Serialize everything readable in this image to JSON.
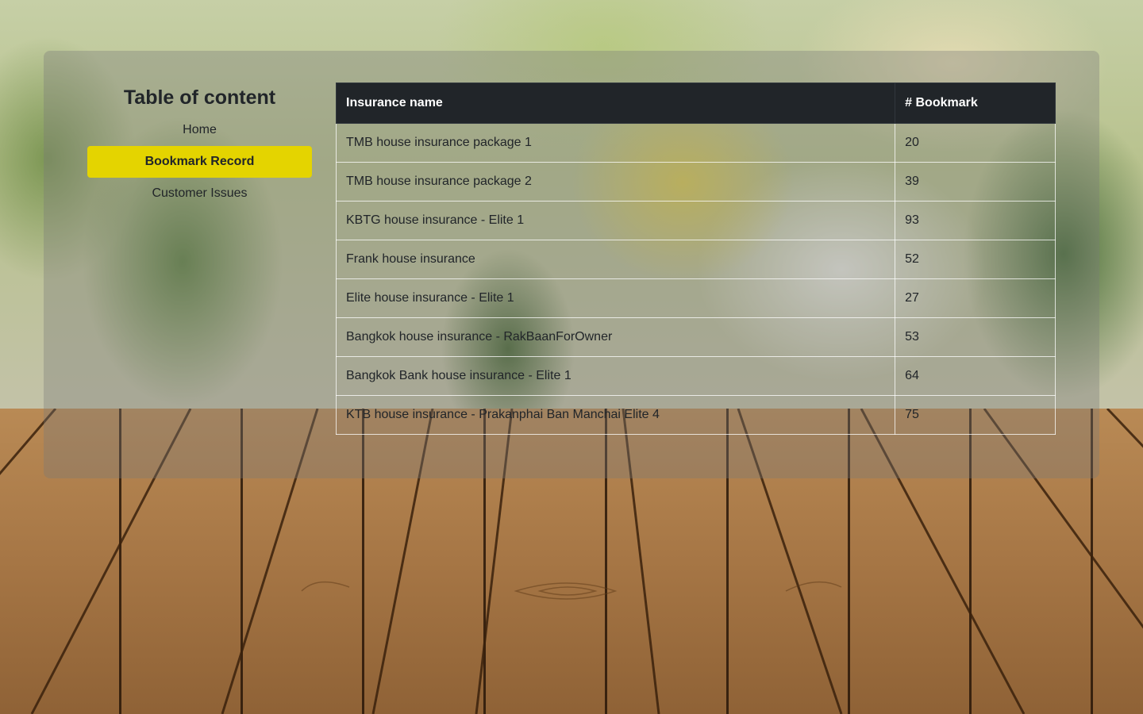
{
  "sidebar": {
    "title": "Table of content",
    "items": [
      {
        "label": "Home",
        "active": false
      },
      {
        "label": "Bookmark Record",
        "active": true
      },
      {
        "label": "Customer Issues",
        "active": false
      }
    ]
  },
  "table": {
    "headers": [
      "Insurance name",
      "# Bookmark"
    ],
    "rows": [
      {
        "name": "TMB house insurance package 1",
        "bookmarks": "20"
      },
      {
        "name": "TMB house insurance package 2",
        "bookmarks": "39"
      },
      {
        "name": "KBTG house insurance - Elite 1",
        "bookmarks": "93"
      },
      {
        "name": "Frank house insurance",
        "bookmarks": "52"
      },
      {
        "name": "Elite house insurance - Elite 1",
        "bookmarks": "27"
      },
      {
        "name": "Bangkok house insurance - RakBaanForOwner",
        "bookmarks": "53"
      },
      {
        "name": "Bangkok Bank house insurance - Elite 1",
        "bookmarks": "64"
      },
      {
        "name": "KTB house insurance - Prakanphai Ban Manchai Elite 4",
        "bookmarks": "75"
      }
    ]
  },
  "colors": {
    "active_nav": "#e4d400",
    "table_header": "#212529",
    "text": "#212529"
  }
}
